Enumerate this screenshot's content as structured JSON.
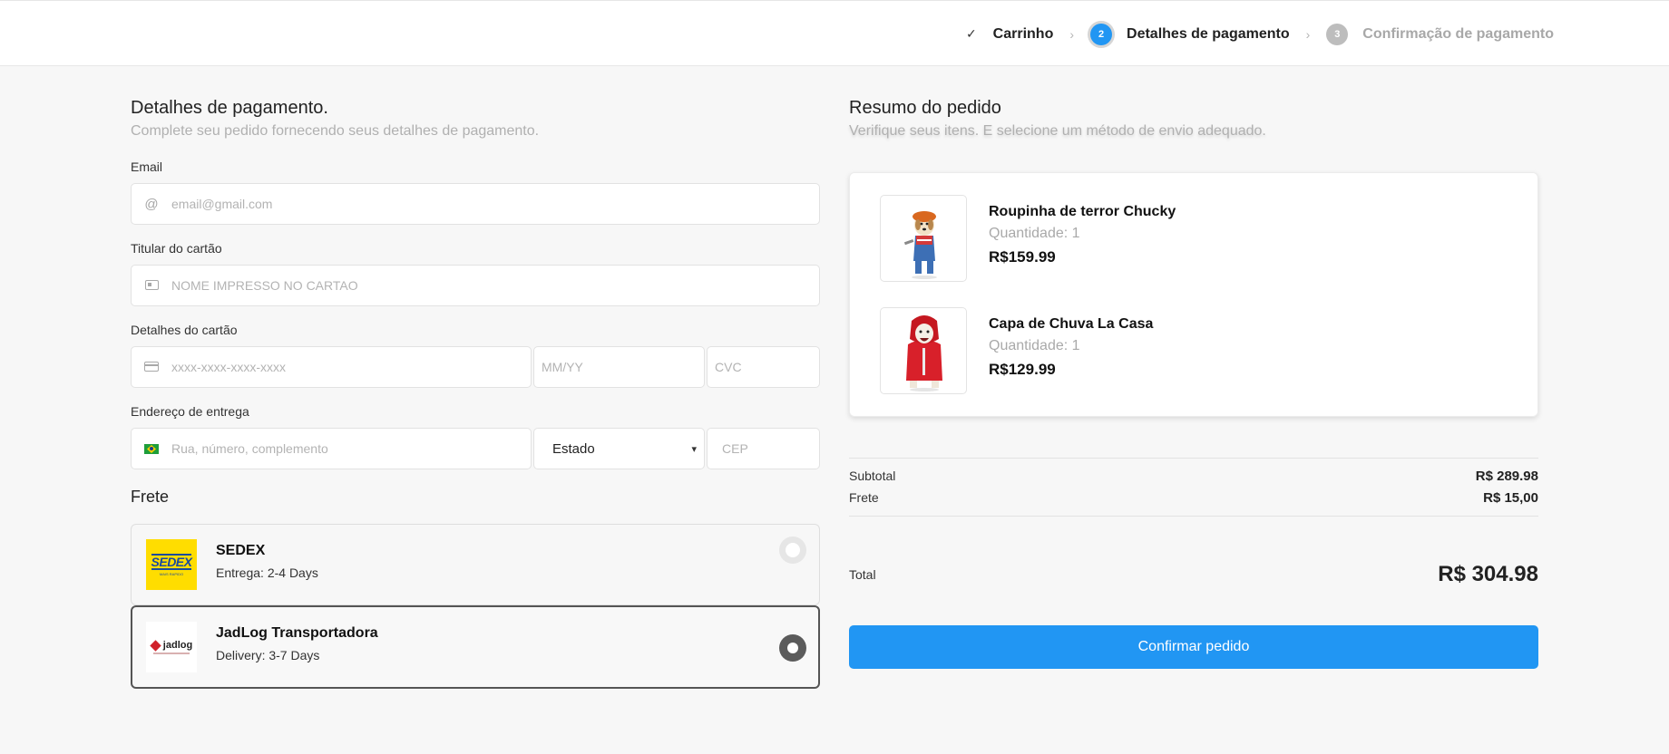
{
  "stepper": {
    "step1": {
      "label": "Carrinho",
      "icon": "check-icon"
    },
    "step2": {
      "number": "2",
      "label": "Detalhes de pagamento"
    },
    "step3": {
      "number": "3",
      "label": "Confirmação de pagamento"
    }
  },
  "payment": {
    "title": "Detalhes de pagamento.",
    "subtitle": "Complete seu pedido fornecendo seus detalhes de pagamento.",
    "email": {
      "label": "Email",
      "icon_glyph": "@",
      "placeholder": "email@gmail.com"
    },
    "holder": {
      "label": "Titular do cartão",
      "placeholder": "NOME IMPRESSO NO CARTAO"
    },
    "card": {
      "label": "Detalhes do cartão",
      "number_placeholder": "xxxx-xxxx-xxxx-xxxx",
      "expiry_placeholder": "MM/YY",
      "cvc_placeholder": "CVC"
    },
    "address": {
      "label": "Endereço de entrega",
      "street_placeholder": "Rua, número, complemento",
      "state_value": "Estado",
      "zip_placeholder": "CEP"
    }
  },
  "shipping": {
    "title": "Frete",
    "options": [
      {
        "name": "SEDEX",
        "time": "Entrega: 2-4 Days",
        "logo_text": "SEDEX",
        "logo_tag": "MAIS RAPIDO",
        "selected": false
      },
      {
        "name": "JadLog Transportadora",
        "time": "Delivery: 3-7 Days",
        "logo_text": "jadlog",
        "selected": true
      }
    ]
  },
  "summary": {
    "title": "Resumo do pedido",
    "subtitle": "Verifique seus itens. E selecione um método de envio adequado.",
    "items": [
      {
        "name": "Roupinha de terror Chucky",
        "qty": "Quantidade: 1",
        "price": "R$159.99"
      },
      {
        "name": "Capa de Chuva La Casa",
        "qty": "Quantidade: 1",
        "price": "R$129.99"
      }
    ],
    "subtotal_label": "Subtotal",
    "subtotal_value": "R$ 289.98",
    "shipping_label": "Frete",
    "shipping_value": "R$ 15,00",
    "total_label": "Total",
    "total_value": "R$ 304.98",
    "confirm_label": "Confirmar pedido"
  },
  "colors": {
    "accent": "#2196f3",
    "step_inactive": "#bdbdbd",
    "sedex_yellow": "#ffdd00",
    "sedex_blue": "#1a4b9b",
    "jadlog_red": "#d0202a"
  }
}
